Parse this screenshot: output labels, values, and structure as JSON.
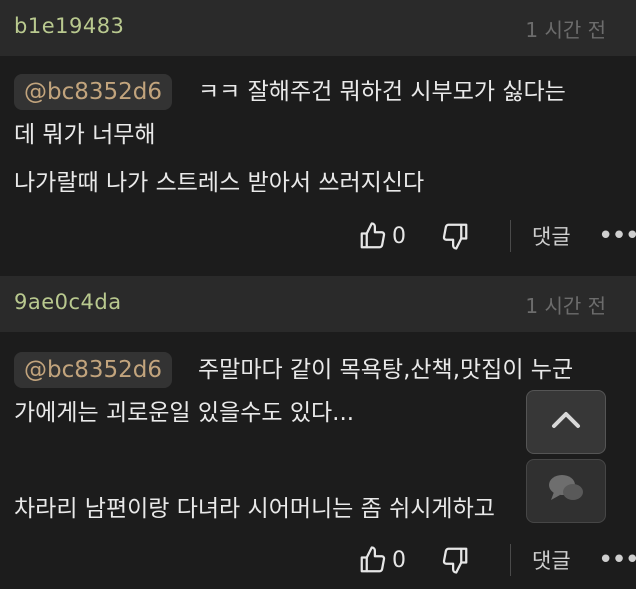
{
  "comments": [
    {
      "author": "b1e19483",
      "time": "1 시간 전",
      "mention": "@bc8352d6",
      "lines": [
        "ㅋㅋ 잘해주건 뭐하건 시부모가 싫다는",
        "데 뭐가 너무해",
        "나가랄때 나가 스트레스 받아서 쓰러지신다"
      ],
      "likes": "0",
      "reply_label": "댓글",
      "more_label": "•••"
    },
    {
      "author": "9ae0c4da",
      "time": "1 시간 전",
      "mention": "@bc8352d6",
      "lines": [
        "주말마다 같이 목욕탕,산책,맛집이 누군",
        "가에게는 괴로운일 있을수도 있다...",
        "",
        "차라리 남편이랑 다녀라 시어머니는 좀 쉬시게하고"
      ],
      "likes": "0",
      "reply_label": "댓글",
      "more_label": "•••"
    }
  ],
  "floating": {
    "scroll_top_icon": "chevron-up-icon",
    "comment_icon": "chat-bubble-icon"
  },
  "colors": {
    "background": "#1c1c1c",
    "header_bg": "#2a2a2a",
    "author": "#b9c98f",
    "mention": "#c2a47d",
    "time": "#6c6c6c"
  }
}
